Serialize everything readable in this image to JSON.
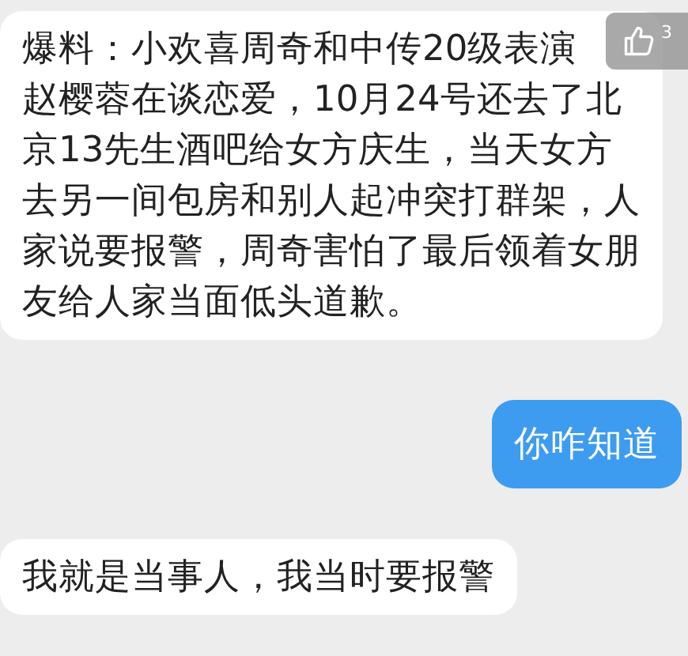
{
  "messages": [
    {
      "kind": "received",
      "lines": [
        "爆料：小欢喜周奇和中传20级表演",
        "赵樱蓉在谈恋爱，10月24号还去了北",
        "京13先生酒吧给女方庆生，当天女方",
        "去另一间包房和别人起冲突打群架，人",
        "家说要报警，周奇害怕了最后领着女朋",
        "友给人家当面低头道歉。"
      ],
      "likes": "3"
    },
    {
      "kind": "sent",
      "lines": [
        "你咋知道"
      ]
    },
    {
      "kind": "received",
      "lines": [
        "我就是当事人，我当时要报警"
      ]
    }
  ]
}
